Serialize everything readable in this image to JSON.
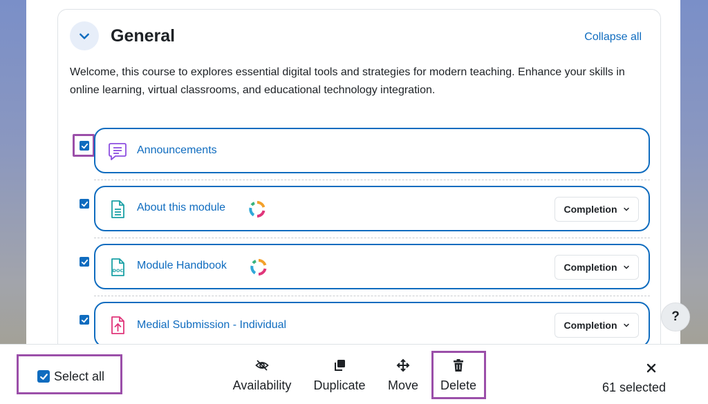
{
  "section": {
    "title": "General",
    "collapse_all": "Collapse all",
    "summary": "Welcome, this course to explores essential digital tools and strategies for modern teaching. Enhance your skills in online learning, virtual classrooms, and educational technology integration."
  },
  "activities": [
    {
      "name": "Announcements",
      "icon": "forum-icon",
      "checked": true,
      "completion": ""
    },
    {
      "name": "About this module",
      "icon": "page-icon",
      "checked": true,
      "completion": "Completion"
    },
    {
      "name": "Module Handbook",
      "icon": "doc-file-icon",
      "checked": true,
      "completion": "Completion"
    },
    {
      "name": "Medial Submission - Individual",
      "icon": "assignment-icon",
      "checked": true,
      "completion": "Completion"
    }
  ],
  "help": {
    "label": "?"
  },
  "bulk": {
    "select_all": "Select all",
    "availability": "Availability",
    "duplicate": "Duplicate",
    "move": "Move",
    "delete": "Delete",
    "selected_count": "61 selected"
  },
  "colors": {
    "link": "#0f6cbf",
    "highlight": "#9b4fa9",
    "forum": "#8d4fe0",
    "page": "#1aa0a6",
    "assignment": "#e0357a"
  }
}
